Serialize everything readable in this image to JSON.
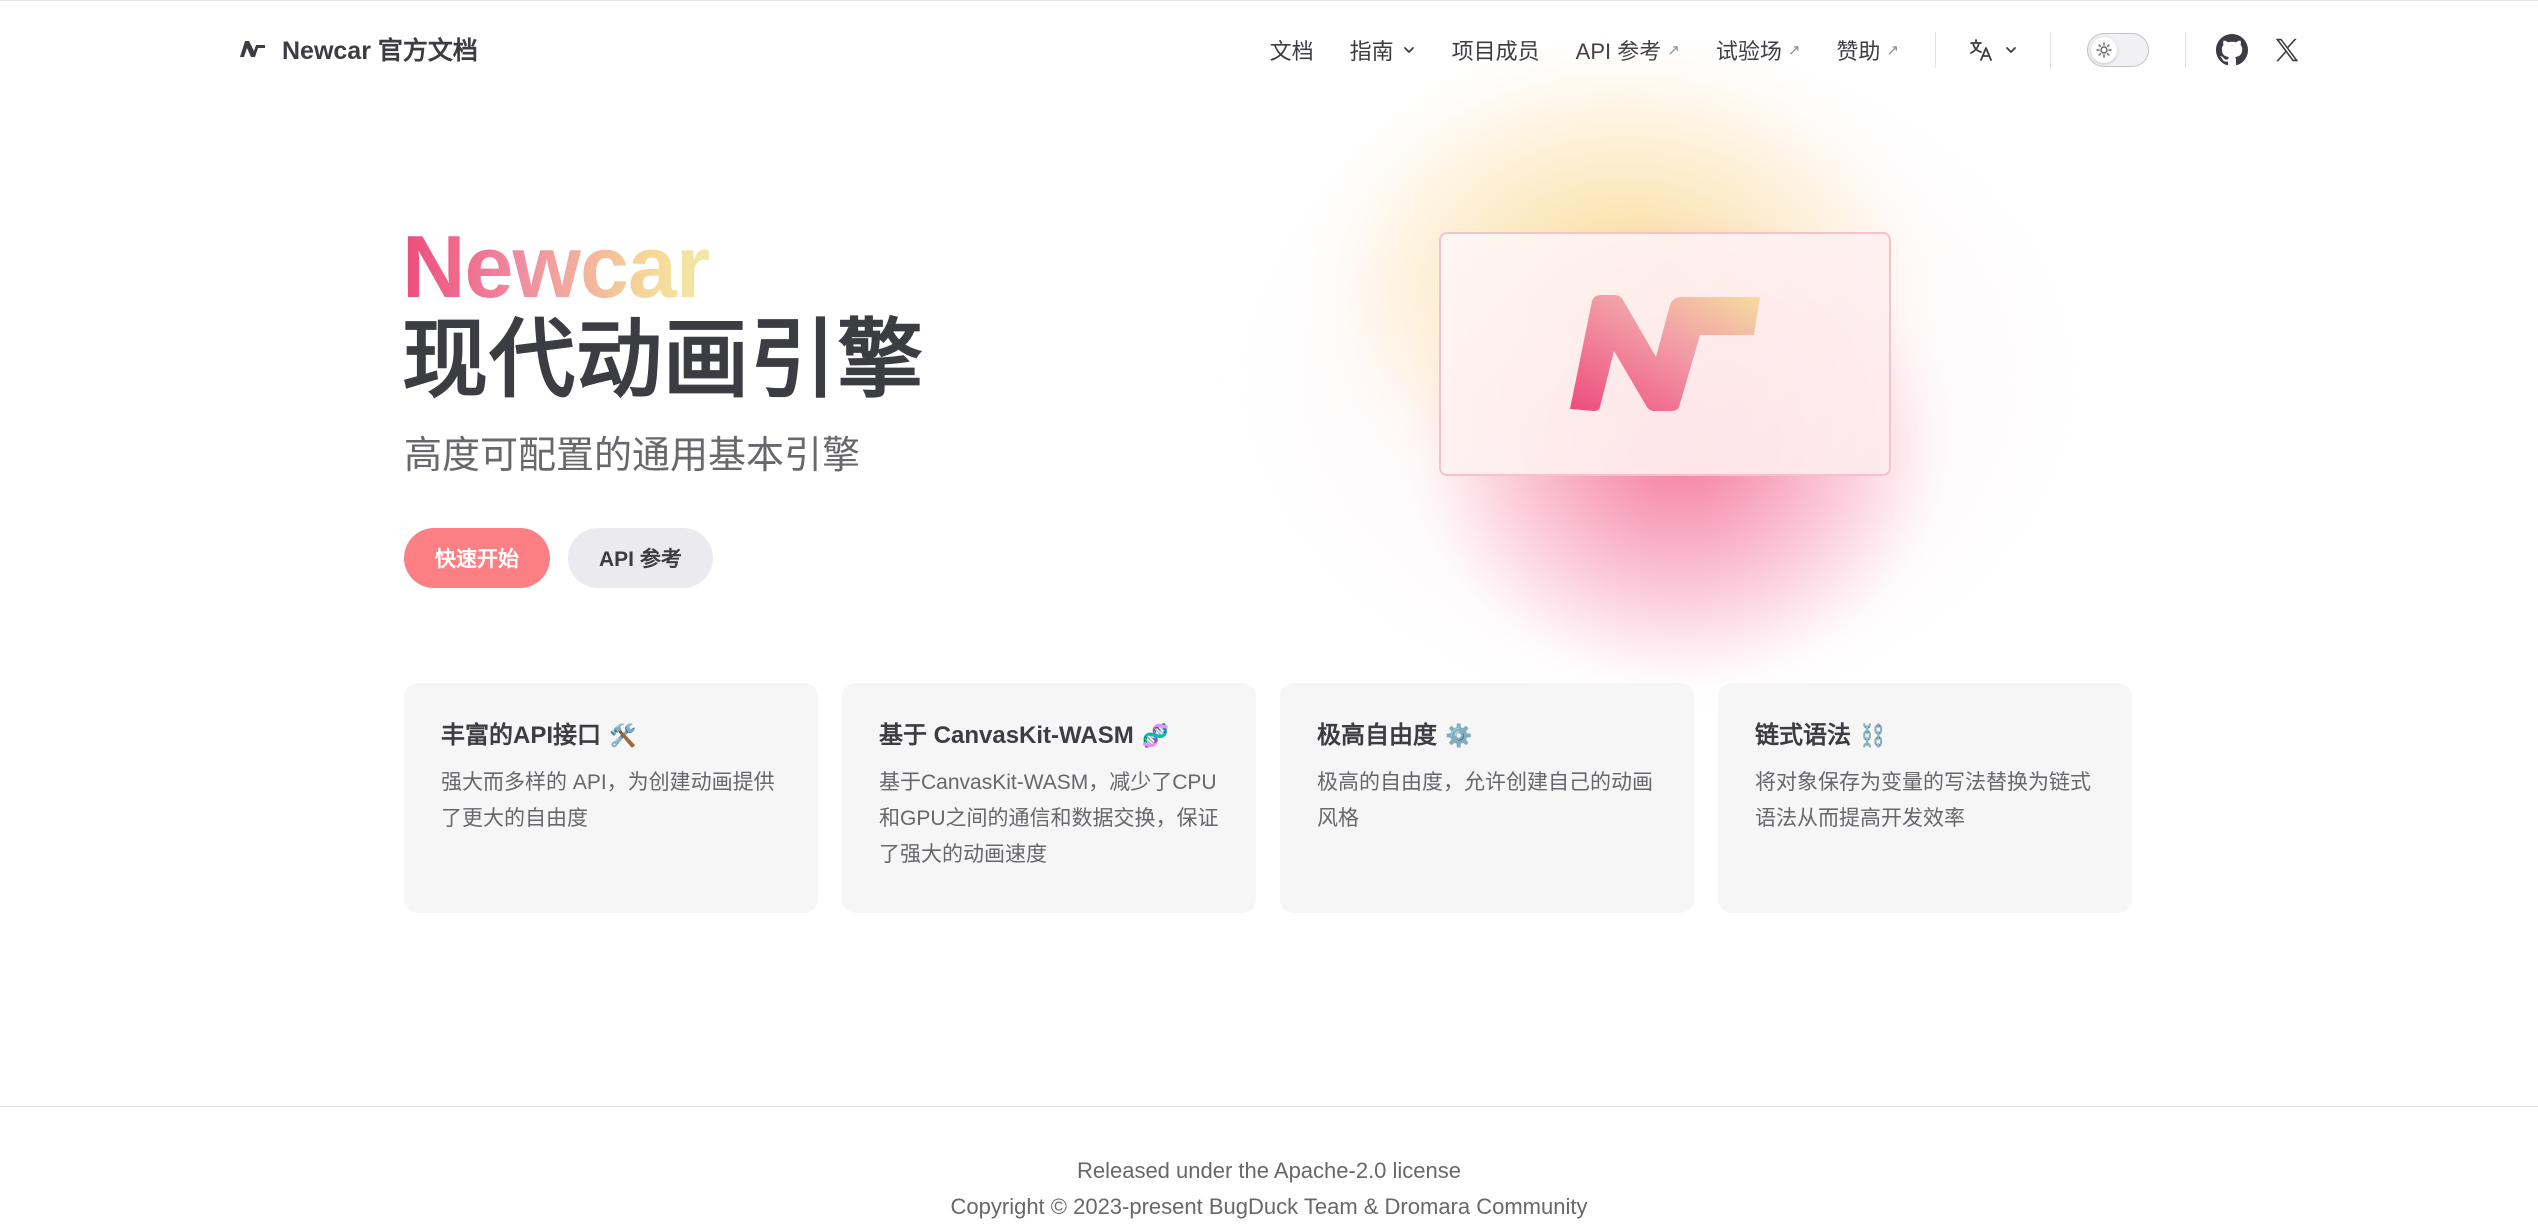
{
  "nav": {
    "title": "Newcar 官方文档",
    "items": [
      {
        "label": "文档"
      },
      {
        "label": "指南",
        "dropdown": true
      },
      {
        "label": "项目成员"
      },
      {
        "label": "API 参考",
        "external": true
      },
      {
        "label": "试验场",
        "external": true
      },
      {
        "label": "赞助",
        "external": true
      }
    ],
    "language_icon": "translate-icon",
    "appearance_toggle_icon": "sun-icon",
    "social": [
      "github-icon",
      "x-icon"
    ]
  },
  "hero": {
    "name": "Newcar",
    "text": "现代动画引擎",
    "tagline": "高度可配置的通用基本引擎",
    "actions": [
      {
        "label": "快速开始",
        "theme": "brand"
      },
      {
        "label": "API 参考",
        "theme": "alt"
      }
    ]
  },
  "features": [
    {
      "title": "丰富的API接口",
      "icon": "🛠️",
      "details": "强大而多样的 API，为创建动画提供了更大的自由度"
    },
    {
      "title": "基于 CanvasKit-WASM",
      "icon": "🧬",
      "details": "基于CanvasKit-WASM，减少了CPU和GPU之间的通信和数据交换，保证了强大的动画速度"
    },
    {
      "title": "极高自由度",
      "icon": "⚙️",
      "details": "极高的自由度，允许创建自己的动画风格"
    },
    {
      "title": "链式语法",
      "icon": "⛓️",
      "details": "将对象保存为变量的写法替换为链式语法从而提高开发效率"
    }
  ],
  "footer": {
    "message": "Released under the Apache-2.0 license",
    "copyright": "Copyright © 2023-present BugDuck Team & Dromara Community"
  },
  "colors": {
    "brand": "#fc8083",
    "text": "#3c3c43",
    "muted": "#67676c",
    "card_bg": "#f6f6f7",
    "gradient_start": "#ee4b7c",
    "gradient_end": "#f3e8a6"
  }
}
